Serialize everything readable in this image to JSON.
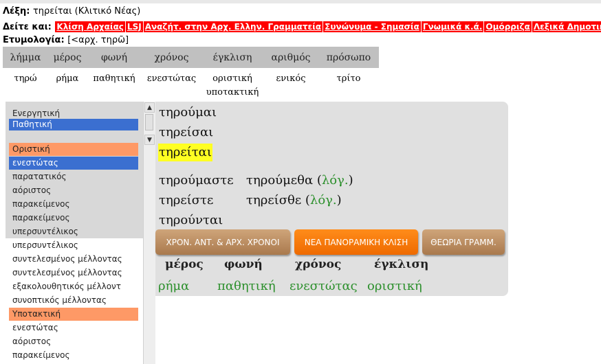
{
  "header": {
    "word_label": "Λέξη:",
    "word_value": "τηρείται (Κλιτικό Νέας)",
    "see_label": "Δείτε και:",
    "see_links": [
      "Κλίση Αρχαίας",
      "LSJ",
      "Αναζήτ. στην Αρχ. Ελλην. Γραμματεία",
      "Συνώνυμα - Σημασία",
      "Γνωμικά κ.ά.",
      "Ομόρριζα",
      "Λεξικά Δημοτικού"
    ],
    "ety_label": "Ετυμολογία:",
    "ety_value": "[<αρχ. τηρῶ]"
  },
  "morph_table": {
    "headers": [
      "λήμμα",
      "μέρος",
      "φωνή",
      "χρόνος",
      "έγκλιση",
      "αριθμός",
      "πρόσωπο"
    ],
    "values": [
      "τηρώ",
      "ρήμα",
      "παθητική",
      "ενεστώτας",
      "οριστική υποτακτική",
      "ενικός",
      "τρίτο"
    ]
  },
  "left_panel": {
    "voices": [
      "Ενεργητική",
      "Παθητική"
    ],
    "selected_voice": "Παθητική",
    "moods": [
      {
        "label": "Οριστική",
        "tenses": [
          "ενεστώτας",
          "παρατατικός",
          "αόριστος",
          "παρακείμενος",
          "παρακείμενος",
          "υπερσυντέλικος",
          "υπερσυντέλικος",
          "συντελεσμένος μέλλοντας",
          "συντελεσμένος μέλλοντας",
          "εξακολουθητικός μέλλοντ",
          "συνοπτικός μέλλοντας"
        ]
      },
      {
        "label": "Υποτακτική",
        "tenses": [
          "ενεστώτας",
          "αόριστος",
          "παρακείμενος"
        ]
      }
    ],
    "selected_tense": "ενεστώτας"
  },
  "conjugation": {
    "singular": [
      "τηρούμαι",
      "τηρείσαι",
      "τηρείται"
    ],
    "highlighted": "τηρείται",
    "plural": [
      {
        "form": "τηρούμαστε",
        "alt": "τηρούμεθα",
        "note": "λόγ."
      },
      {
        "form": "τηρείστε",
        "alt": "τηρείσθε",
        "note": "λόγ."
      },
      {
        "form": "τηρούνται",
        "alt": "",
        "note": ""
      }
    ]
  },
  "buttons": [
    "ΧΡΟΝ. ΑΝΤ. & ΑΡΧ. ΧΡΟΝΟΙ",
    "ΝΕΑ ΠΑΝΟΡΑΜΙΚΗ ΚΛΙΣΗ",
    "ΘΕΩΡΙΑ ΓΡΑΜΜ."
  ],
  "summary": {
    "headers": [
      "μέρος",
      "φωνή",
      "χρόνος",
      "έγκλιση"
    ],
    "values": [
      "ρήμα",
      "παθητική",
      "ενεστώτας",
      "οριστική"
    ]
  },
  "colors": {
    "link_bg": "#ff0000",
    "selected": "#3b6fd0",
    "mood": "#fe9966",
    "highlight": "#ffff22",
    "green": "#2b8f2b",
    "orange_btn": "#ff7a00",
    "brown_btn": "#b98658"
  }
}
